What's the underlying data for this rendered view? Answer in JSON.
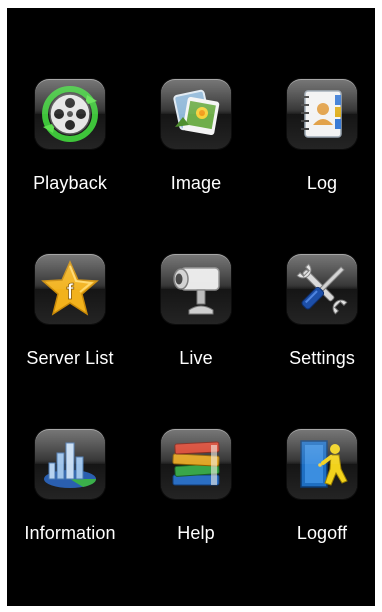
{
  "menu": {
    "items": [
      {
        "label": "Playback",
        "icon": "film-reel-play-icon"
      },
      {
        "label": "Image",
        "icon": "photo-gallery-icon"
      },
      {
        "label": "Log",
        "icon": "contact-notebook-icon"
      },
      {
        "label": "Server List",
        "icon": "star-f-icon"
      },
      {
        "label": "Live",
        "icon": "security-camera-icon"
      },
      {
        "label": "Settings",
        "icon": "wrench-screwdriver-icon"
      },
      {
        "label": "Information",
        "icon": "building-chart-icon"
      },
      {
        "label": "Help",
        "icon": "books-icon"
      },
      {
        "label": "Logoff",
        "icon": "exit-door-icon"
      }
    ]
  },
  "colors": {
    "background": "#000000",
    "label": "#ffffff",
    "play_green": "#3ec43a",
    "star_gold": "#f2b21c",
    "door_blue": "#1f6fc2"
  }
}
